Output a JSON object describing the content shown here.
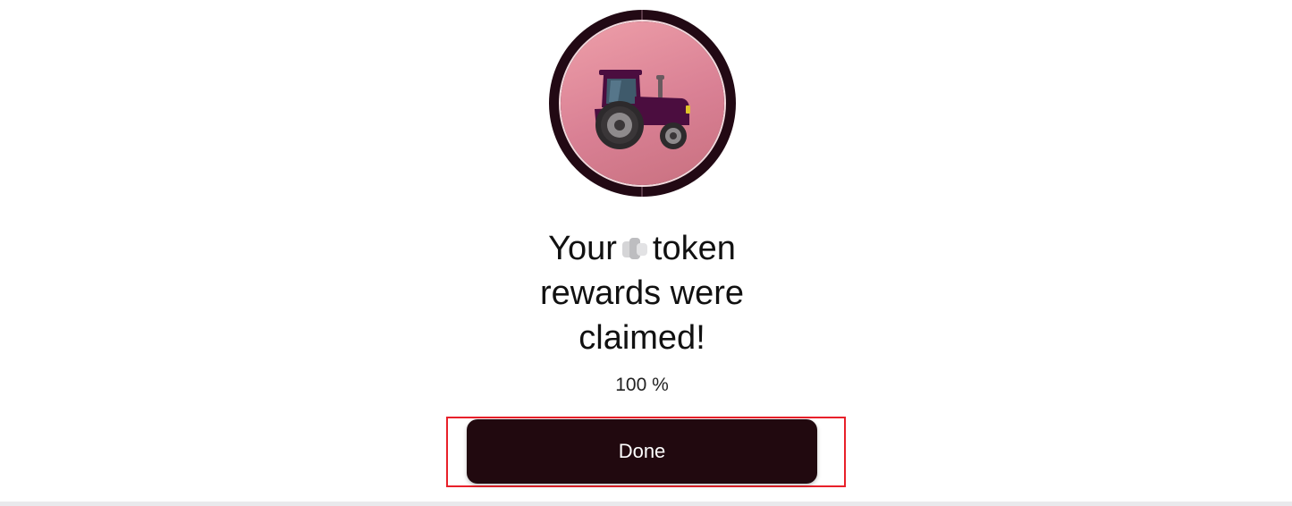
{
  "dialog": {
    "title_part1": "Your",
    "title_part2": "token",
    "title_line2": "rewards were",
    "title_line3": "claimed!",
    "progress_text": "100 %",
    "done_label": "Done"
  },
  "icons": {
    "main": "tractor-icon",
    "token": "token-icon"
  },
  "colors": {
    "ring": "#220914",
    "avatar_bg": "#e3909f",
    "button_bg": "#21090f",
    "button_text": "#ffffff",
    "highlight": "#e8202a"
  }
}
